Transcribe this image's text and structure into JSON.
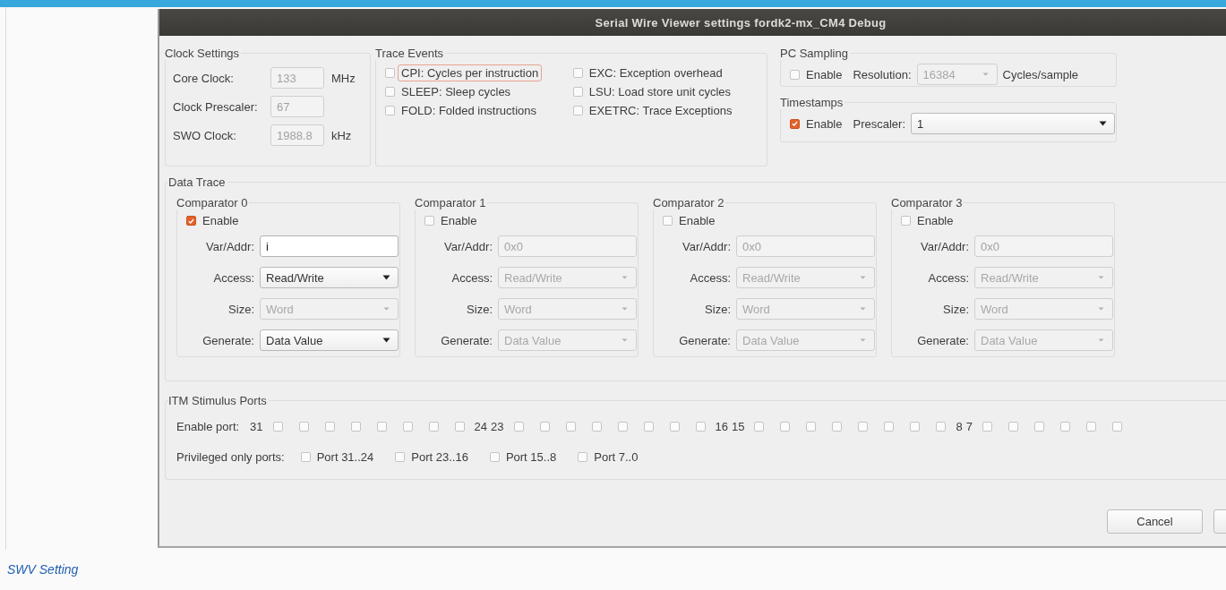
{
  "dialog": {
    "title": "Serial Wire Viewer settings fordk2-mx_CM4 Debug",
    "clock_settings": {
      "title": "Clock Settings",
      "rows": [
        {
          "label": "Core Clock:",
          "value": "133",
          "unit": "MHz",
          "disabled": true
        },
        {
          "label": "Clock Prescaler:",
          "value": "67",
          "disabled": true
        },
        {
          "label": "SWO Clock:",
          "value": "1988.8",
          "unit": "kHz",
          "disabled": true
        }
      ]
    },
    "trace_events": {
      "title": "Trace Events",
      "items": [
        {
          "label": "CPI: Cycles per instruction",
          "checked": false,
          "focused": true
        },
        {
          "label": "EXC: Exception overhead",
          "checked": false,
          "focused": false
        },
        {
          "label": "SLEEP: Sleep cycles",
          "checked": false,
          "focused": false
        },
        {
          "label": "LSU: Load store unit cycles",
          "checked": false,
          "focused": false
        },
        {
          "label": "FOLD: Folded instructions",
          "checked": false,
          "focused": false
        },
        {
          "label": "EXETRC: Trace Exceptions",
          "checked": false,
          "focused": false
        }
      ]
    },
    "pc_sampling": {
      "title": "PC Sampling",
      "enable": {
        "label": "Enable",
        "checked": false
      },
      "resolution_label": "Resolution:",
      "resolution": {
        "value": "16384",
        "disabled": true
      },
      "unit": "Cycles/sample"
    },
    "timestamps": {
      "title": "Timestamps",
      "enable": {
        "label": "Enable",
        "checked": true
      },
      "prescaler_label": "Prescaler:",
      "prescaler": {
        "value": "1",
        "disabled": false
      }
    },
    "data_trace": {
      "title": "Data Trace",
      "comparators": [
        {
          "title": "Comparator 0",
          "enable": {
            "label": "Enable",
            "checked": true
          },
          "fields": [
            {
              "kind": "text",
              "label": "Var/Addr:",
              "value": "i",
              "disabled": false
            },
            {
              "kind": "combo",
              "label": "Access:",
              "value": "Read/Write",
              "disabled": false
            },
            {
              "kind": "combo",
              "label": "Size:",
              "value": "Word",
              "disabled": true
            },
            {
              "kind": "combo",
              "label": "Generate:",
              "value": "Data Value",
              "disabled": false
            }
          ]
        },
        {
          "title": "Comparator 1",
          "enable": {
            "label": "Enable",
            "checked": false
          },
          "fields": [
            {
              "kind": "text",
              "label": "Var/Addr:",
              "value": "0x0",
              "disabled": true
            },
            {
              "kind": "combo",
              "label": "Access:",
              "value": "Read/Write",
              "disabled": true
            },
            {
              "kind": "combo",
              "label": "Size:",
              "value": "Word",
              "disabled": true
            },
            {
              "kind": "combo",
              "label": "Generate:",
              "value": "Data Value",
              "disabled": true
            }
          ]
        },
        {
          "title": "Comparator 2",
          "enable": {
            "label": "Enable",
            "checked": false
          },
          "fields": [
            {
              "kind": "text",
              "label": "Var/Addr:",
              "value": "0x0",
              "disabled": true
            },
            {
              "kind": "combo",
              "label": "Access:",
              "value": "Read/Write",
              "disabled": true
            },
            {
              "kind": "combo",
              "label": "Size:",
              "value": "Word",
              "disabled": true
            },
            {
              "kind": "combo",
              "label": "Generate:",
              "value": "Data Value",
              "disabled": true
            }
          ]
        },
        {
          "title": "Comparator 3",
          "enable": {
            "label": "Enable",
            "checked": false
          },
          "fields": [
            {
              "kind": "text",
              "label": "Var/Addr:",
              "value": "0x0",
              "disabled": true
            },
            {
              "kind": "combo",
              "label": "Access:",
              "value": "Read/Write",
              "disabled": true
            },
            {
              "kind": "combo",
              "label": "Size:",
              "value": "Word",
              "disabled": true
            },
            {
              "kind": "combo",
              "label": "Generate:",
              "value": "Data Value",
              "disabled": true
            }
          ]
        }
      ]
    },
    "itm": {
      "title": "ITM Stimulus Ports",
      "enable_label": "Enable port:",
      "port_groups": [
        {
          "high": "31",
          "low": "24",
          "checked": [
            false,
            false,
            false,
            false,
            false,
            false,
            false,
            false
          ]
        },
        {
          "high": "23",
          "low": "16",
          "checked": [
            false,
            false,
            false,
            false,
            false,
            false,
            false,
            false
          ]
        },
        {
          "high": "15",
          "low": "8",
          "checked": [
            false,
            false,
            false,
            false,
            false,
            false,
            false,
            false
          ]
        },
        {
          "high": "7",
          "checked": [
            false,
            false,
            false,
            false,
            false,
            false
          ]
        }
      ],
      "privileged_label": "Privileged only ports:",
      "privileged": [
        {
          "label": "Port 31..24",
          "checked": false
        },
        {
          "label": "Port 23..16",
          "checked": false
        },
        {
          "label": "Port 15..8",
          "checked": false
        },
        {
          "label": "Port 7..0",
          "checked": false
        }
      ]
    },
    "buttons": [
      "Cancel"
    ]
  },
  "caption": "SWV Setting"
}
